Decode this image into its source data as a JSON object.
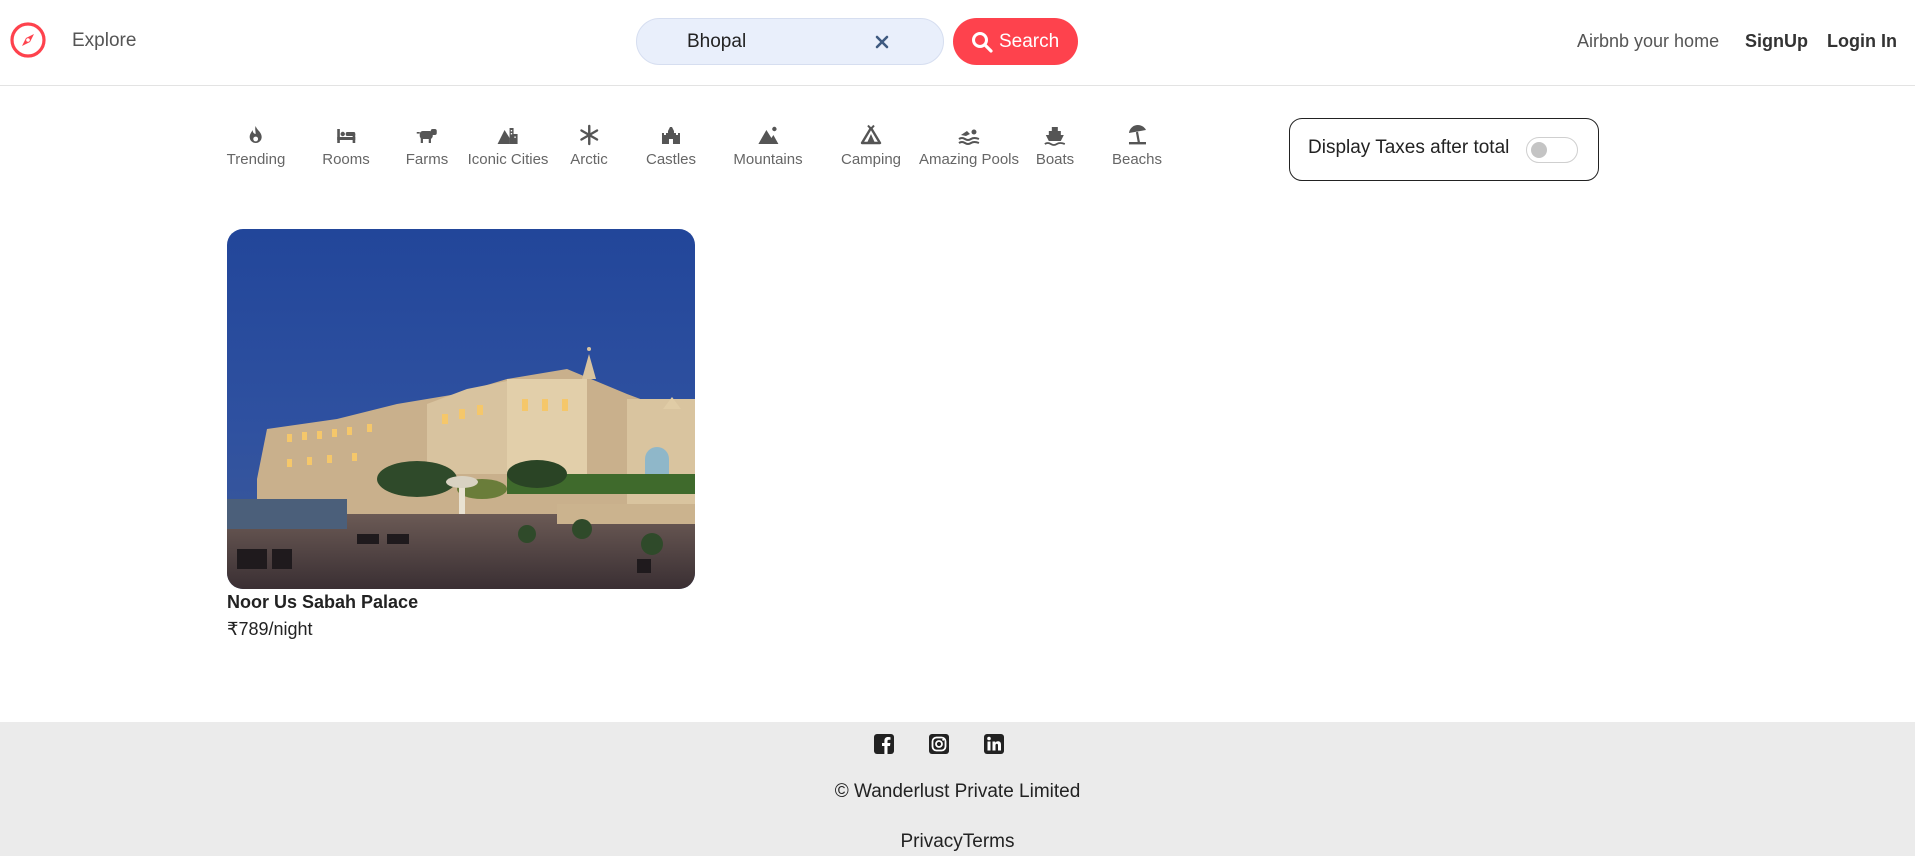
{
  "nav": {
    "logo_icon": "compass-icon",
    "explore_label": "Explore",
    "search_value": "Bhopal",
    "search_button_label": "Search",
    "host_label": "Airbnb your home",
    "signup_label": "SignUp",
    "login_label": "Login In",
    "brand_color": "#fe424d"
  },
  "filters": [
    {
      "label": "Trending",
      "icon": "fire-icon"
    },
    {
      "label": "Rooms",
      "icon": "bed-icon"
    },
    {
      "label": "Farms",
      "icon": "cow-icon"
    },
    {
      "label": "Iconic Cities",
      "icon": "mountain-city-icon"
    },
    {
      "label": "Arctic",
      "icon": "snowflake-icon"
    },
    {
      "label": "Castles",
      "icon": "castle-icon"
    },
    {
      "label": "Mountains",
      "icon": "mountain-icon"
    },
    {
      "label": "Camping",
      "icon": "tent-icon"
    },
    {
      "label": "Amazing Pools",
      "icon": "swimmer-icon"
    },
    {
      "label": "Boats",
      "icon": "ship-icon"
    },
    {
      "label": "Beachs",
      "icon": "umbrella-beach-icon"
    }
  ],
  "tax_toggle": {
    "label": "Display Taxes after total",
    "enabled": false
  },
  "listings": [
    {
      "title": "Noor Us Sabah Palace",
      "price": "₹789/night"
    }
  ],
  "footer": {
    "socials": [
      "facebook-icon",
      "instagram-icon",
      "linkedin-icon"
    ],
    "copyright": "© Wanderlust Private Limited",
    "privacy_label": "Privacy",
    "terms_label": "Terms",
    "background": "#ebebeb"
  }
}
